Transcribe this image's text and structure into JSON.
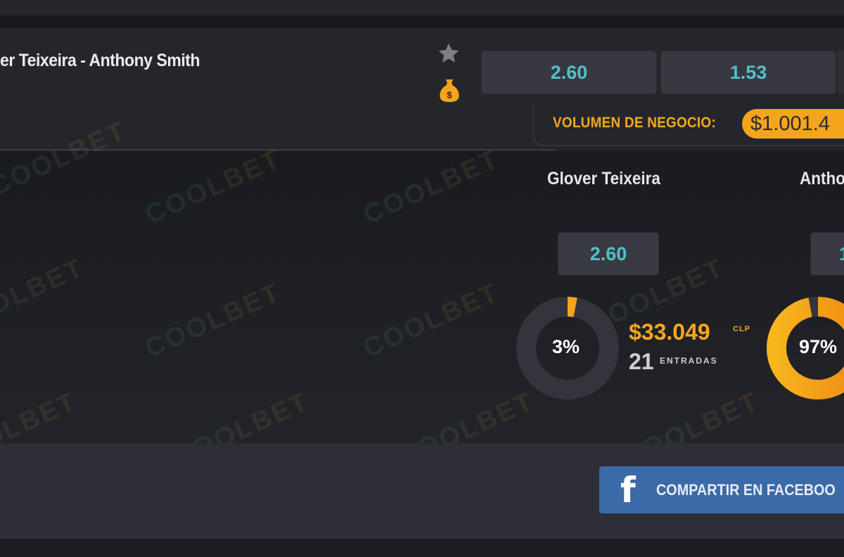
{
  "match": {
    "title": "er Teixeira  -  Anthony Smith",
    "odds": [
      "2.60",
      "1.53"
    ],
    "icons": {
      "favorite": "star-icon",
      "money": "money-bag-icon"
    }
  },
  "volume": {
    "label": "VOLUMEN DE NEGOCIO:",
    "amount": "$1.001.4"
  },
  "watermark": "COOLBET",
  "fighters": [
    {
      "name": "Glover Teixeira",
      "odds": "2.60",
      "percent_label": "3%",
      "percent": 3,
      "amount": "$33.049",
      "amount_unit": "CLP",
      "entries": "21",
      "entries_label": "ENTRADAS"
    },
    {
      "name": "Antho",
      "odds": "1",
      "percent_label": "97%",
      "percent": 97
    }
  ],
  "share": {
    "label": "COMPARTIR EN FACEBOO",
    "icon": "facebook-icon"
  },
  "colors": {
    "accent": "#f3a81e",
    "odds_text": "#4fc2c8",
    "facebook": "#3b6aa8",
    "donut_track": "#34353c"
  }
}
